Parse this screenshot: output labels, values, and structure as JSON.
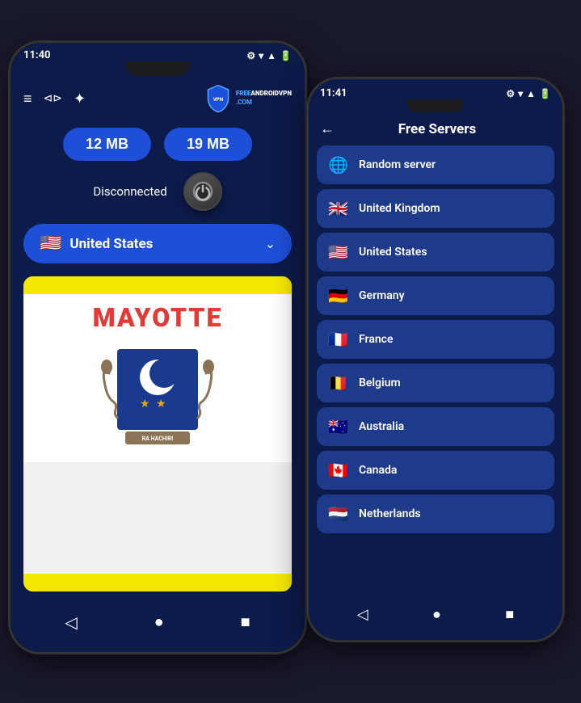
{
  "back_phone": {
    "status": {
      "time": "11:40",
      "icons": [
        "⚙",
        "▲",
        "▼",
        "📶",
        "🔋"
      ]
    },
    "top_icons": [
      "≡",
      "⊂⊃",
      "✦"
    ],
    "logo": {
      "shield_text": "FREE ANDROID VPN",
      "domain": ".COM"
    },
    "stats": {
      "download": "12 MB",
      "upload": "19 MB"
    },
    "status_label": "Disconnected",
    "country": {
      "flag": "🇺🇸",
      "name": "United States"
    },
    "map_title": "MAYOTTE",
    "bottom_nav": [
      "◁",
      "●",
      "■"
    ]
  },
  "front_phone": {
    "status": {
      "time": "11:41",
      "icons": [
        "⚙",
        "▲",
        "▼",
        "📶",
        "🔋"
      ]
    },
    "header": {
      "back_label": "←",
      "title": "Free Servers"
    },
    "servers": [
      {
        "id": "random",
        "flag": "🌐",
        "name": "Random server"
      },
      {
        "id": "uk",
        "flag": "🇬🇧",
        "name": "United Kingdom"
      },
      {
        "id": "us",
        "flag": "🇺🇸",
        "name": "United States"
      },
      {
        "id": "de",
        "flag": "🇩🇪",
        "name": "Germany"
      },
      {
        "id": "fr",
        "flag": "🇫🇷",
        "name": "France"
      },
      {
        "id": "be",
        "flag": "🇧🇪",
        "name": "Belgium"
      },
      {
        "id": "au",
        "flag": "🇦🇺",
        "name": "Australia"
      },
      {
        "id": "ca",
        "flag": "🇨🇦",
        "name": "Canada"
      },
      {
        "id": "nl",
        "flag": "🇳🇱",
        "name": "Netherlands"
      }
    ],
    "bottom_nav": [
      "◁",
      "●",
      "■"
    ]
  }
}
